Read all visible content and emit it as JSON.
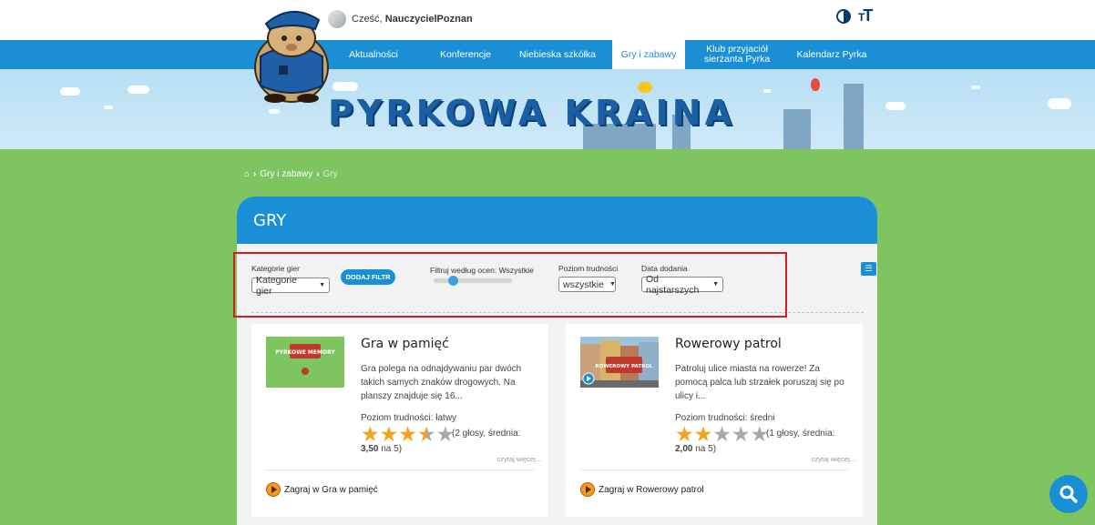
{
  "header": {
    "greeting": "Cześć,",
    "user": "NauczycielPoznan",
    "contrast_icon": "contrast-icon",
    "fontsize_icon": "font-size-icon"
  },
  "nav": {
    "items": [
      {
        "label": "Aktualności"
      },
      {
        "label": "Konferencje"
      },
      {
        "label": "Niebieska szkółka"
      },
      {
        "label": "Gry i zabawy"
      },
      {
        "label": "Klub przyjaciół sierżanta Pyrka"
      },
      {
        "label": "Kalendarz Pyrka"
      }
    ],
    "active": "Gry i zabawy"
  },
  "banner": {
    "title": "PYRKOWA KRAINA"
  },
  "breadcrumb": {
    "items": [
      "Gry i zabawy",
      "Gry"
    ]
  },
  "panel": {
    "title": "GRY"
  },
  "filters": {
    "categories_label": "Kategorie gier",
    "categories_value": "Kategorie gier",
    "add_filter": "DODAJ FILTR",
    "rating_label": "Filtruj według ocen: Wszystkie",
    "difficulty_label": "Poziom trudności",
    "difficulty_value": "wszystkie",
    "date_label": "Data dodania",
    "date_value": "Od najstarszych"
  },
  "games": [
    {
      "title": "Gra w pamięć",
      "description": "Gra polega na odnajdywaniu par dwóch takich samych znaków drogowych. Na planszy znajduje się 16...",
      "difficulty": "Poziom trudności: łatwy",
      "rating": 3.5,
      "votes_text": "(2 głosy, średnia:",
      "avg_value": "3,50",
      "avg_suffix": "na 5)",
      "more": "czytaj więcej...",
      "play": "Zagraj w Gra w pamięć",
      "thumb_text": "PYRKOWE MEMORY",
      "thumb_color": "#7ec561"
    },
    {
      "title": "Rowerowy patrol",
      "description": "Patroluj ulice miasta na rowerze! Za pomocą palca lub strzałek poruszaj się po ulicy i...",
      "difficulty": "Poziom trudności: średni",
      "rating": 2.0,
      "votes_text": "(1 głosy, średnia:",
      "avg_value": "2,00",
      "avg_suffix": "na 5)",
      "more": "czytaj więcej...",
      "play": "Zagraj w Rowerowy patrol",
      "thumb_text": "ROWEROWY PATROL",
      "thumb_color": "#c9a27a"
    }
  ],
  "colors": {
    "primary": "#1b8fd6",
    "background": "#7ec561",
    "star": "#f3a21a",
    "highlight": "#d21f1f"
  }
}
